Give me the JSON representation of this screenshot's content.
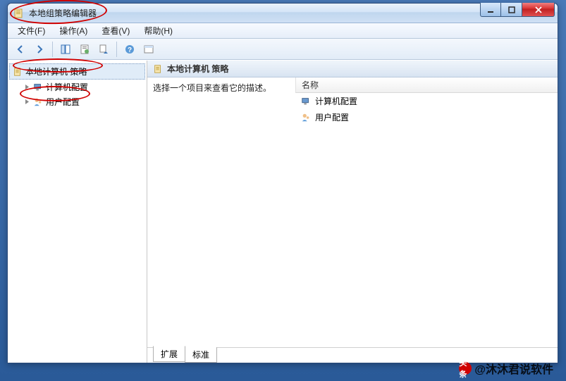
{
  "window": {
    "title": "本地组策略编辑器"
  },
  "menu": {
    "file": "文件(F)",
    "action": "操作(A)",
    "view": "查看(V)",
    "help": "帮助(H)"
  },
  "tree": {
    "root": "本地计算机 策略",
    "children": [
      "计算机配置",
      "用户配置"
    ]
  },
  "detail": {
    "header": "本地计算机 策略",
    "description": "选择一个项目来查看它的描述。",
    "name_column": "名称",
    "items": [
      "计算机配置",
      "用户配置"
    ]
  },
  "tabs": {
    "extended": "扩展",
    "standard": "标准"
  },
  "watermark": {
    "prefix": "头条",
    "text": "@沐沐君说软件"
  }
}
